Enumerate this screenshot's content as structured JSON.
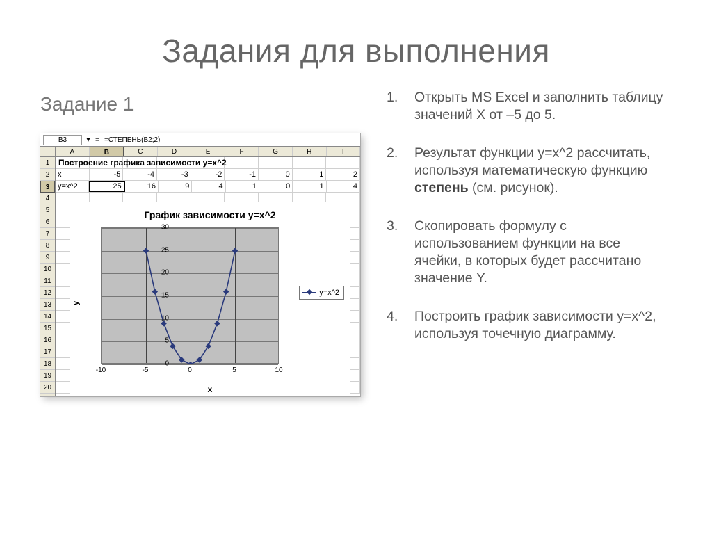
{
  "title": "Задания для выполнения",
  "subtitle": "Задание 1",
  "excel": {
    "cellref": "B3",
    "formula": "=СТЕПЕНЬ(B2;2)",
    "columns": [
      "A",
      "B",
      "C",
      "D",
      "E",
      "F",
      "G",
      "H",
      "I"
    ],
    "rownums": [
      "1",
      "2",
      "3",
      "4",
      "5",
      "6",
      "7",
      "8",
      "9",
      "10",
      "11",
      "12",
      "13",
      "14",
      "15",
      "16",
      "17",
      "18",
      "19",
      "20"
    ],
    "row1_title": "Построение графика зависимости у=х^2",
    "row2": [
      "x",
      "-5",
      "-4",
      "-3",
      "-2",
      "-1",
      "0",
      "1",
      "2"
    ],
    "row3": [
      "у=х^2",
      "25",
      "16",
      "9",
      "4",
      "1",
      "0",
      "1",
      "4"
    ]
  },
  "chart_data": {
    "type": "scatter",
    "title": "График зависимости у=х^2",
    "xlabel": "x",
    "ylabel": "y",
    "legend": "y=x^2",
    "xlim": [
      -10,
      10
    ],
    "ylim": [
      0,
      30
    ],
    "xticks": [
      -10,
      -5,
      0,
      5,
      10
    ],
    "yticks": [
      0,
      5,
      10,
      15,
      20,
      25,
      30
    ],
    "series": [
      {
        "name": "y=x^2",
        "x": [
          -5,
          -4,
          -3,
          -2,
          -1,
          0,
          1,
          2,
          3,
          4,
          5
        ],
        "values": [
          25,
          16,
          9,
          4,
          1,
          0,
          1,
          4,
          9,
          16,
          25
        ]
      }
    ]
  },
  "instructions": [
    {
      "n": "1.",
      "text": "Открыть MS Excel и заполнить таблицу значений Х от –5 до 5."
    },
    {
      "n": "2.",
      "text": "Результат функции у=х^2 рассчитать, используя математическую функцию ",
      "bold": "степень",
      "tail": " (см. рисунок)."
    },
    {
      "n": "3.",
      "text": "Скопировать формулу с использованием функции на все ячейки, в которых будет рассчитано значение Y."
    },
    {
      "n": "4.",
      "text": "Построить график зависимости у=х^2, используя точечную диаграмму."
    }
  ]
}
